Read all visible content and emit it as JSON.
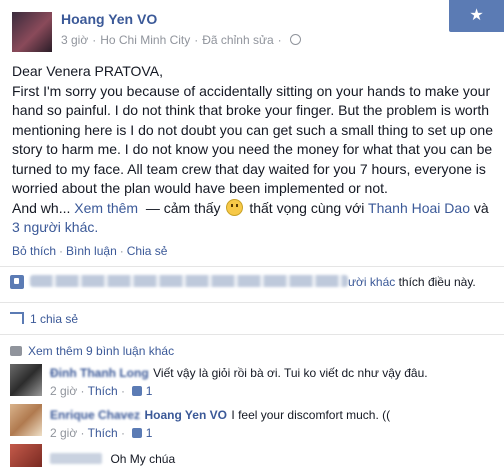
{
  "post": {
    "author": "Hoang Yen VO",
    "time": "3 giờ",
    "location": "Ho Chi Minh City",
    "edited": "Đã chỉnh sửa",
    "message_lines": [
      "Dear Venera PRATOVA,",
      "First I'm sorry you because of accidentally sitting on your hands to make your hand so painful. I do not think that broke your finger. But the problem is worth mentioning here is I do not doubt you can get such a small thing to set up one story to harm me. I do not know you need the money for what that you can be turned to my face. All team crew that day waited for you 7 hours, everyone is worried about the plan would have been implemented or not."
    ],
    "message_tail": "And wh...",
    "see_more": "Xem thêm",
    "feeling_prefix": "— cảm thấy",
    "feeling": "thất vọng",
    "with_text": "cùng với",
    "tagged": "Thanh Hoai Dao",
    "and_text": "và",
    "others": "3 người khác."
  },
  "actions": {
    "like": "Bỏ thích",
    "comment": "Bình luận",
    "share": "Chia sẻ"
  },
  "likes": {
    "others_link": "ười khác",
    "suffix": "thích điều này."
  },
  "shares": {
    "label": "1 chia sẻ"
  },
  "more_comments": {
    "label": "Xem thêm 9 bình luận khác"
  },
  "comments": [
    {
      "name": "Đinh Thanh Long",
      "text": "Viết vậy là giỏi rồi bà ơi. Tui ko viết dc như vậy đâu.",
      "time": "2 giờ",
      "like": "Thích",
      "likes": "1"
    },
    {
      "name": "Enrique Chavez",
      "mention": "Hoang Yen VO",
      "text": "I feel your discomfort much. ((",
      "time": "2 giờ",
      "like": "Thích",
      "likes": "1"
    },
    {
      "name": "",
      "text": "Oh My chúa"
    }
  ],
  "colors": {
    "link": "#3b5998",
    "muted": "#90949c",
    "text": "#141823"
  }
}
